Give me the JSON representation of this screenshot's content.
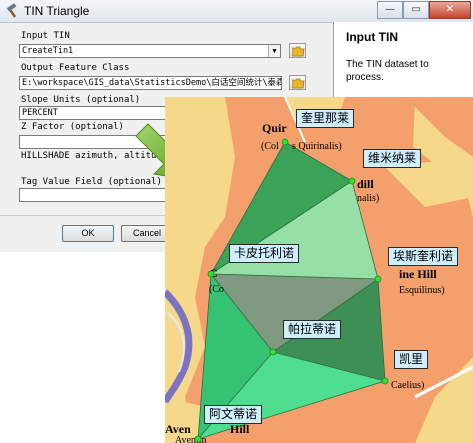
{
  "window": {
    "title": "TIN Triangle",
    "min": "—",
    "max": "▭",
    "close": "✕"
  },
  "form": {
    "input_tin": {
      "label": "Input TIN",
      "value": "CreateTin1"
    },
    "output_feature_class": {
      "label": "Output Feature Class",
      "value": "E:\\workspace\\GIS_data\\StatisticsDemo\\白话空间统计\\泰森多边"
    },
    "slope_units": {
      "label": "Slope Units (optional)",
      "value": "PERCENT"
    },
    "z_factor": {
      "label": "Z Factor (optional)"
    },
    "hillshade": {
      "label": "HILLSHADE azimuth, altitude (o"
    },
    "tag_value_field": {
      "label": "Tag Value Field (optional)"
    },
    "ok_label": "OK",
    "cancel_label": "Cancel"
  },
  "help": {
    "title": "Input TIN",
    "text": "The TIN dataset to process."
  },
  "map": {
    "map_labels": {
      "quir": "Quir",
      "col_quir": "(Col",
      "col_quir2": "s Quirinalis)",
      "dill": "dill",
      "nalis": "nalis)",
      "c": "C",
      "co": "(Co",
      "ine_hill": "ine Hill",
      "esquilinus": "Esquilinus)",
      "caelius": "Caelius)",
      "aven": "Aven",
      "hill": "Hill",
      "aventin": "Aventin"
    },
    "callouts": [
      {
        "id": "quirinal",
        "text": "奎里那莱"
      },
      {
        "id": "viminal",
        "text": "维米纳莱"
      },
      {
        "id": "capitoline",
        "text": "卡皮托利诺"
      },
      {
        "id": "esquiline",
        "text": "埃斯奎利诺"
      },
      {
        "id": "palatine",
        "text": "帕拉蒂诺"
      },
      {
        "id": "caelian",
        "text": "凯里"
      },
      {
        "id": "aventine",
        "text": "阿文蒂诺"
      }
    ]
  },
  "colors": {
    "map_bg": "#f6d88a",
    "city": "#f3a06d",
    "river": "#7c73bf",
    "triangle_dark": "#3aa357",
    "triangle_light": "#96dfa6",
    "triangle_gray": "#7f9a80",
    "node": "#33e033",
    "arrow": "#6aaa2e"
  }
}
